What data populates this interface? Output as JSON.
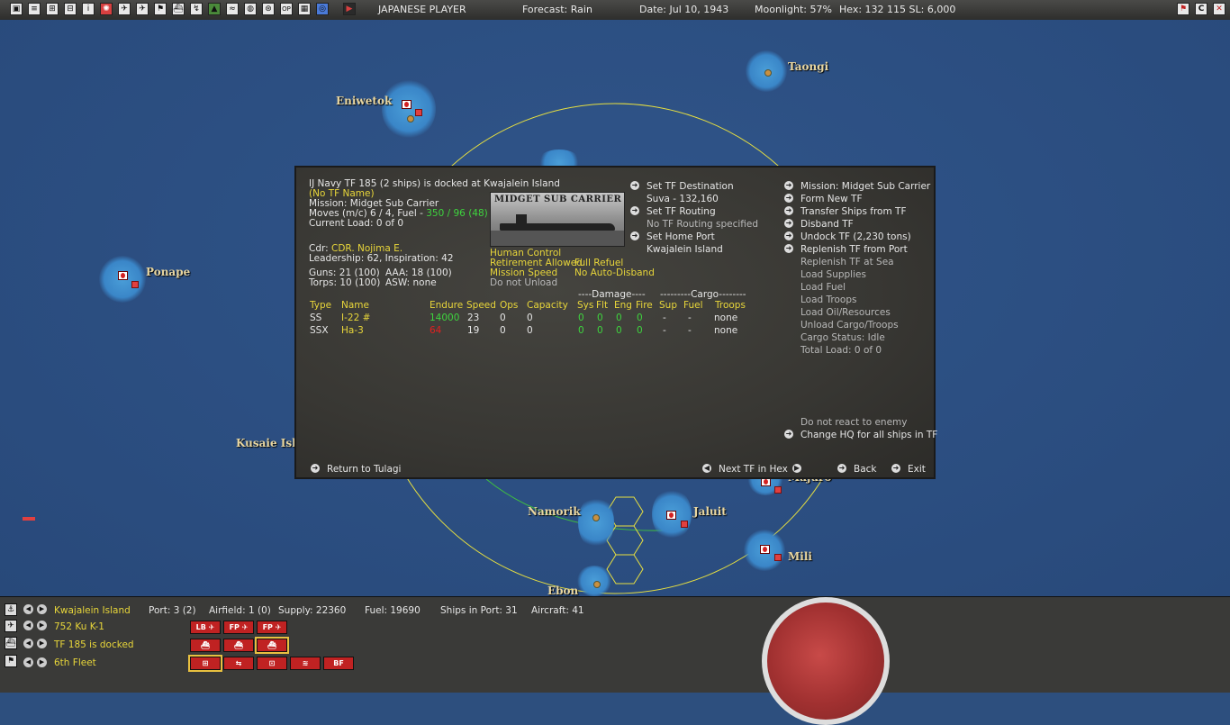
{
  "topbar": {
    "player": "JAPANESE PLAYER",
    "forecast": "Forecast: Rain",
    "date": "Date: Jul 10, 1943",
    "moonlight": "Moonlight: 57%",
    "hex": "Hex: 132 115  SL: 6,000"
  },
  "map": {
    "labels": {
      "taongi": "Taongi",
      "eniwetok": "Eniwetok",
      "ponape": "Ponape",
      "kusaie": "Kusaie Isla",
      "namorik": "Namorik",
      "jaluit": "Jaluit",
      "majuro": "Majuro",
      "mili": "Mili",
      "ebon": "Ebon"
    }
  },
  "dialog": {
    "header": "IJ Navy TF 185 (2 ships) is docked at Kwajalein Island",
    "tf_name": "(No TF Name)",
    "mission": "Mission:  Midget Sub Carrier",
    "moves_prefix": "Moves (m/c)  6 / 4, Fuel - ",
    "moves_fuel": "350 / 96 (48)",
    "current_load": "Current Load:  0 of 0",
    "image_caption": "MIDGET SUB CARRIER",
    "cdr_label": "Cdr:",
    "cdr_name": "CDR. Nojima E.",
    "leadership": "Leadership: 62, Inspiration: 42",
    "guns": "Guns: 21 (100)",
    "aaa": "AAA: 18 (100)",
    "torps": "Torps: 10 (100)",
    "asw": "ASW: none",
    "settings": {
      "human_control": "Human Control",
      "retirement": "Retirement Allowed",
      "full_refuel": "Full Refuel",
      "mission_speed": "Mission Speed",
      "auto_disband": "No Auto-Disband",
      "unload": "Do not Unload"
    },
    "routing": {
      "set_destination": "Set TF Destination",
      "destination_value": "Suva - 132,160",
      "set_routing": "Set TF Routing",
      "routing_value": "No TF Routing specified",
      "set_home_port": "Set Home Port",
      "home_port_value": "Kwajalein Island"
    },
    "actions": {
      "mission": "Mission: Midget Sub Carrier",
      "form_new": "Form New TF",
      "transfer": "Transfer Ships from TF",
      "disband": "Disband TF",
      "undock": "Undock TF (2,230 tons)",
      "replenish_port": "Replenish TF from Port",
      "replenish_sea": "Replenish TF at Sea",
      "load_supplies": "Load Supplies",
      "load_fuel": "Load Fuel",
      "load_troops": "Load Troops",
      "load_oil": "Load Oil/Resources",
      "unload_cargo": "Unload Cargo/Troops",
      "cargo_status": "Cargo Status: Idle",
      "total_load": "Total Load: 0 of 0",
      "react": "Do not react to enemy",
      "change_hq": "Change HQ for all ships in TF"
    },
    "table": {
      "damage_group": "----Damage----",
      "cargo_group": "---------Cargo--------",
      "headers": [
        "Type",
        "Name",
        "Endure",
        "Speed",
        "Ops",
        "Capacity",
        "Sys",
        "Flt",
        "Eng",
        "Fire",
        "Sup",
        "Fuel",
        "Troops"
      ],
      "rows": [
        [
          "SS",
          "I-22 #",
          "14000",
          "23",
          "0",
          "0",
          "0",
          "0",
          "0",
          "0",
          "-",
          "-",
          "none"
        ],
        [
          "SSX",
          "Ha-3",
          "64",
          "19",
          "0",
          "0",
          "0",
          "0",
          "0",
          "0",
          "-",
          "-",
          "none"
        ]
      ]
    },
    "footer": {
      "return": "Return to Tulagi",
      "next_tf": "Next TF in Hex",
      "back": "Back",
      "exit": "Exit"
    }
  },
  "bottom": {
    "base": "Kwajalein Island",
    "port": "Port: 3 (2)",
    "airfield": "Airfield: 1 (0)",
    "supply": "Supply: 22360",
    "fuel": "Fuel: 19690",
    "ships_in_port": "Ships in Port: 31",
    "aircraft": "Aircraft: 41",
    "air_unit": "752 Ku K-1",
    "tf_status": "TF 185 is docked",
    "fleet": "6th Fleet",
    "air_buttons": [
      "LB",
      "FP",
      "FP"
    ],
    "bf_label": "BF"
  },
  "colors": {
    "sea": "#2d4f7e",
    "panel": "#3a3a38",
    "highlight": "#e8d63a",
    "ok": "#3ed43e",
    "alert": "#e02020"
  }
}
